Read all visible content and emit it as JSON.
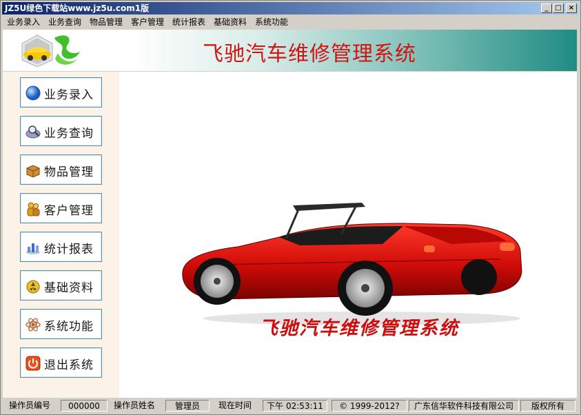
{
  "window": {
    "title": "JZ5U绿色下载站www.jz5u.com1版",
    "minimize": "_",
    "maximize": "□",
    "close": "×"
  },
  "menu": [
    "业务录入",
    "业务查询",
    "物品管理",
    "客户管理",
    "统计报表",
    "基础资料",
    "系统功能"
  ],
  "banner": {
    "title": "飞驰汽车维修管理系统"
  },
  "sidebar": {
    "items": [
      {
        "label": "业务录入",
        "icon": "globe-icon",
        "color": "#3a7fd6"
      },
      {
        "label": "业务查询",
        "icon": "magnifier-icon",
        "color": "#7b7fa6"
      },
      {
        "label": "物品管理",
        "icon": "box-icon",
        "color": "#c8862a"
      },
      {
        "label": "客户管理",
        "icon": "users-icon",
        "color": "#e0a020"
      },
      {
        "label": "统计报表",
        "icon": "bar-chart-icon",
        "color": "#4a78c8"
      },
      {
        "label": "基础资料",
        "icon": "database-icon",
        "color": "#d6b020"
      },
      {
        "label": "系统功能",
        "icon": "atom-icon",
        "color": "#c86a2a"
      },
      {
        "label": "退出系统",
        "icon": "power-icon",
        "color": "#e24a1a"
      }
    ]
  },
  "main": {
    "slogan": "飞驰汽车维修管理系统"
  },
  "statusbar": {
    "operator_id_label": "操作员编号",
    "operator_id": "000000",
    "operator_name_label": "操作员姓名",
    "operator_name": "管理员",
    "time_label": "现在时间",
    "time": "下午 02:53:11",
    "copyright": "© 1999-2012?",
    "company": "广东信华软件科技有限公司",
    "rights": "版权所有"
  },
  "colors": {
    "accent": "#0a246a",
    "title_red": "#d21414",
    "banner_teal": "#1f8c84",
    "sidebar_bg": "#fbf2e8"
  }
}
